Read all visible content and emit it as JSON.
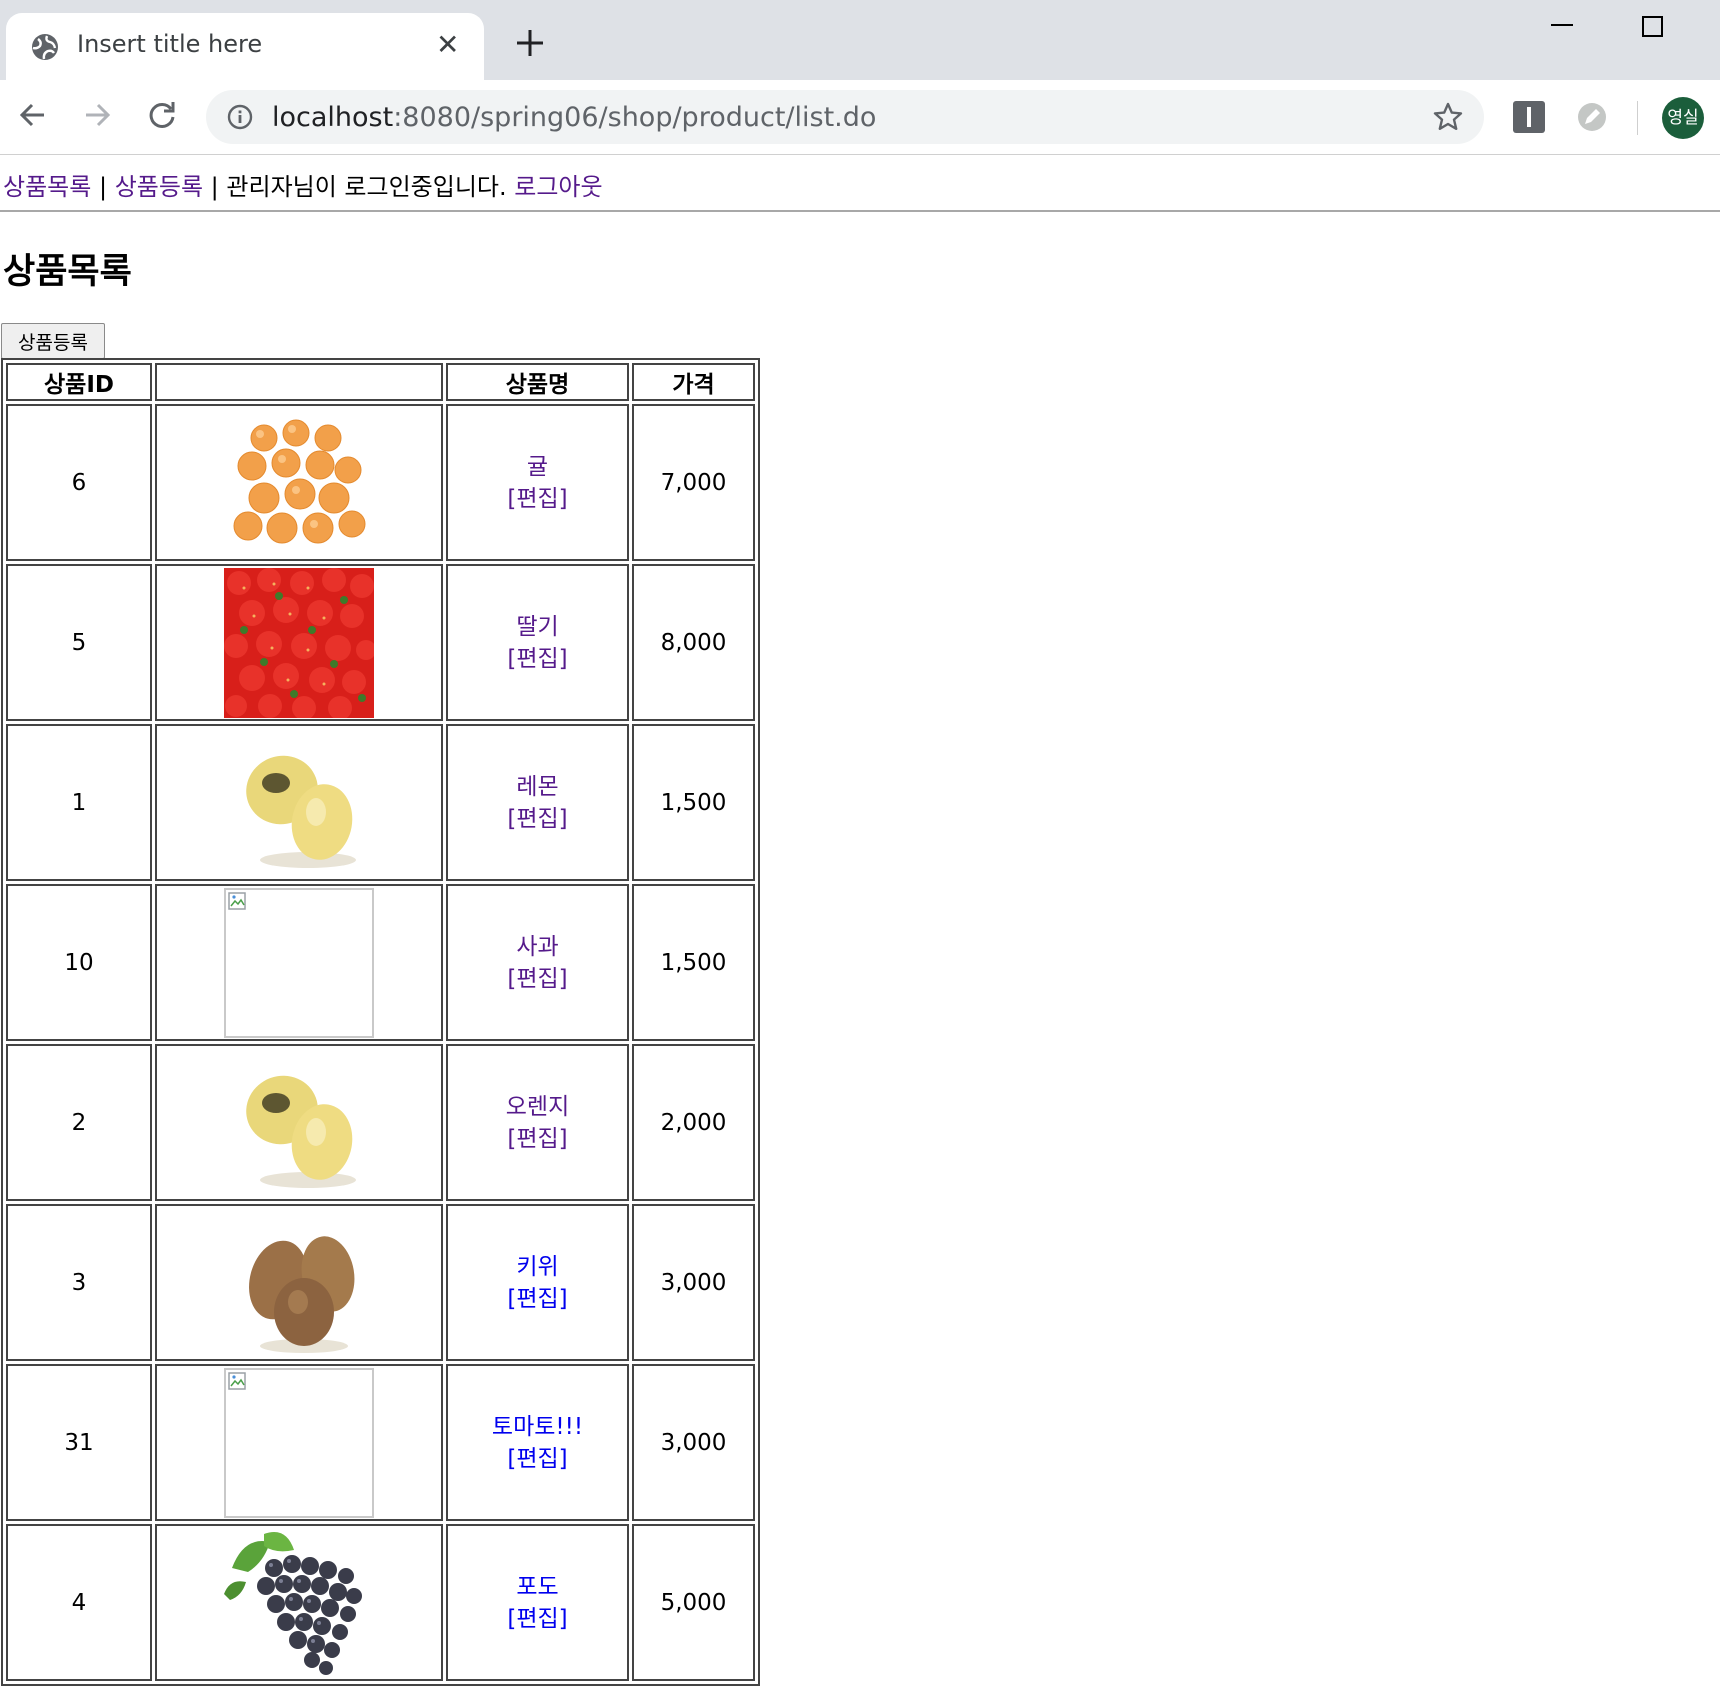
{
  "browser": {
    "tab_title": "Insert title here",
    "url_host": "localhost",
    "url_rest": ":8080/spring06/shop/product/list.do",
    "profile_initials": "영실"
  },
  "menu": {
    "product_list_link": "상품목록",
    "separator": "|",
    "product_add_link": "상품등록",
    "login_status": "관리자님이 로그인중입니다.",
    "logout_link": "로그아웃"
  },
  "page": {
    "title": "상품목록",
    "add_button_label": "상품등록"
  },
  "table": {
    "headers": {
      "id": "상품ID",
      "image": "",
      "name": "상품명",
      "price": "가격"
    },
    "edit_label": "[편집]",
    "rows": [
      {
        "id": "6",
        "image": "tangerines",
        "name": "귤",
        "price": "7,000",
        "visited": true
      },
      {
        "id": "5",
        "image": "strawberries",
        "name": "딸기",
        "price": "8,000",
        "visited": true
      },
      {
        "id": "1",
        "image": "lemons",
        "name": "레몬",
        "price": "1,500",
        "visited": true
      },
      {
        "id": "10",
        "image": "broken",
        "name": "사과",
        "price": "1,500",
        "visited": true
      },
      {
        "id": "2",
        "image": "lemons",
        "name": "오렌지",
        "price": "2,000",
        "visited": true
      },
      {
        "id": "3",
        "image": "kiwis",
        "name": "키위",
        "price": "3,000",
        "visited": false
      },
      {
        "id": "31",
        "image": "broken",
        "name": "토마토!!!",
        "price": "3,000",
        "visited": false
      },
      {
        "id": "4",
        "image": "grapes",
        "name": "포도",
        "price": "5,000",
        "visited": false
      }
    ]
  },
  "colors": {
    "link_visited": "#551a8b",
    "link_unvisited": "#0000ee",
    "chrome_bg": "#dee1e6"
  }
}
